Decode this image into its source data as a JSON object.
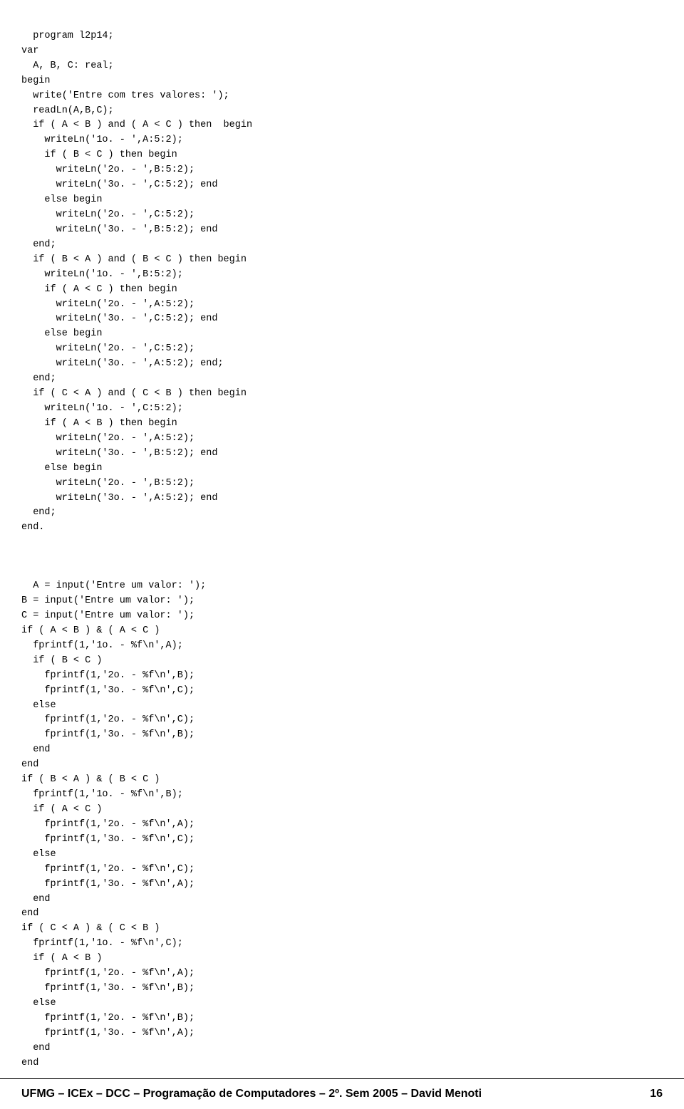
{
  "code": {
    "pascal_block": "program l2p14;\nvar\n  A, B, C: real;\nbegin\n  write('Entre com tres valores: ');\n  readLn(A,B,C);\n  if ( A < B ) and ( A < C ) then  begin\n    writeLn('1o. - ',A:5:2);\n    if ( B < C ) then begin\n      writeLn('2o. - ',B:5:2);\n      writeLn('3o. - ',C:5:2); end\n    else begin\n      writeLn('2o. - ',C:5:2);\n      writeLn('3o. - ',B:5:2); end\n  end;\n  if ( B < A ) and ( B < C ) then begin\n    writeLn('1o. - ',B:5:2);\n    if ( A < C ) then begin\n      writeLn('2o. - ',A:5:2);\n      writeLn('3o. - ',C:5:2); end\n    else begin\n      writeLn('2o. - ',C:5:2);\n      writeLn('3o. - ',A:5:2); end;\n  end;\n  if ( C < A ) and ( C < B ) then begin\n    writeLn('1o. - ',C:5:2);\n    if ( A < B ) then begin\n      writeLn('2o. - ',A:5:2);\n      writeLn('3o. - ',B:5:2); end\n    else begin\n      writeLn('2o. - ',B:5:2);\n      writeLn('3o. - ',A:5:2); end\n  end;\nend.",
    "matlab_block": "A = input('Entre um valor: ');\nB = input('Entre um valor: ');\nC = input('Entre um valor: ');\nif ( A < B ) & ( A < C )\n  fprintf(1,'1o. - %f\\n',A);\n  if ( B < C )\n    fprintf(1,'2o. - %f\\n',B);\n    fprintf(1,'3o. - %f\\n',C);\n  else\n    fprintf(1,'2o. - %f\\n',C);\n    fprintf(1,'3o. - %f\\n',B);\n  end\nend\nif ( B < A ) & ( B < C )\n  fprintf(1,'1o. - %f\\n',B);\n  if ( A < C )\n    fprintf(1,'2o. - %f\\n',A);\n    fprintf(1,'3o. - %f\\n',C);\n  else\n    fprintf(1,'2o. - %f\\n',C);\n    fprintf(1,'3o. - %f\\n',A);\n  end\nend\nif ( C < A ) & ( C < B )\n  fprintf(1,'1o. - %f\\n',C);\n  if ( A < B )\n    fprintf(1,'2o. - %f\\n',A);\n    fprintf(1,'3o. - %f\\n',B);\n  else\n    fprintf(1,'2o. - %f\\n',B);\n    fprintf(1,'3o. - %f\\n',A);\n  end\nend"
  },
  "footer": {
    "left": "UFMG – ICEx – DCC – Programação de Computadores – 2º. Sem 2005 – David Menoti",
    "right": "16"
  }
}
